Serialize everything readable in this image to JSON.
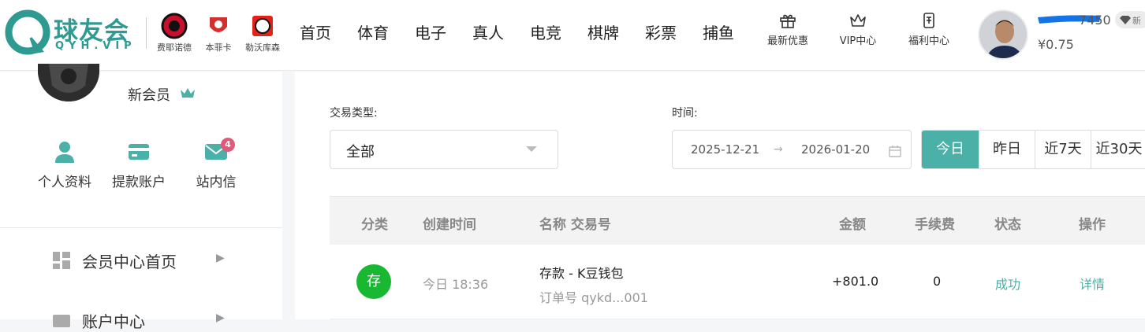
{
  "header": {
    "brand": "球友会",
    "brand_sub": "QYH.VIP",
    "clubs": [
      "费耶诺德",
      "本菲卡",
      "勒沃库森"
    ],
    "nav": [
      "首页",
      "体育",
      "电子",
      "真人",
      "电竞",
      "棋牌",
      "彩票",
      "捕鱼"
    ],
    "quick_links": [
      {
        "label": "最新优惠",
        "icon": "gift-icon"
      },
      {
        "label": "VIP中心",
        "icon": "crown-icon"
      },
      {
        "label": "福利中心",
        "icon": "welfare-icon"
      }
    ],
    "user_tail": "7450",
    "balance": "¥0.75",
    "vip_badge": "新"
  },
  "sidebar": {
    "member_level": "新会员",
    "shortcuts": [
      {
        "label": "个人资料",
        "icon": "person-icon"
      },
      {
        "label": "提款账户",
        "icon": "card-icon"
      },
      {
        "label": "站内信",
        "icon": "mail-icon",
        "badge": "4"
      }
    ],
    "menu": [
      {
        "label": "会员中心首页",
        "icon": "dashboard-icon"
      },
      {
        "label": "账户中心",
        "icon": "wallet-icon"
      }
    ]
  },
  "filters": {
    "type_label": "交易类型:",
    "type_value": "全部",
    "time_label": "时间:",
    "date_start": "2025-12-21",
    "date_end": "2026-01-20",
    "quick_dates": [
      "今日",
      "昨日",
      "近7天",
      "近30天"
    ],
    "active_quick_date": "今日"
  },
  "table": {
    "headers": [
      "分类",
      "创建时间",
      "名称 交易号",
      "金额",
      "手续费",
      "状态",
      "操作"
    ],
    "rows": [
      {
        "category": "存",
        "created": "今日 18:36",
        "name": "存款 - K豆钱包",
        "order_no": "订单号 qykd...001",
        "amount": "+801.0",
        "fee": "0",
        "status": "成功",
        "action": "详情"
      }
    ]
  },
  "colors": {
    "accent": "#4bb0a8",
    "brand": "#2e9a92",
    "deposit": "#19b832",
    "badge": "#e05a7c"
  }
}
